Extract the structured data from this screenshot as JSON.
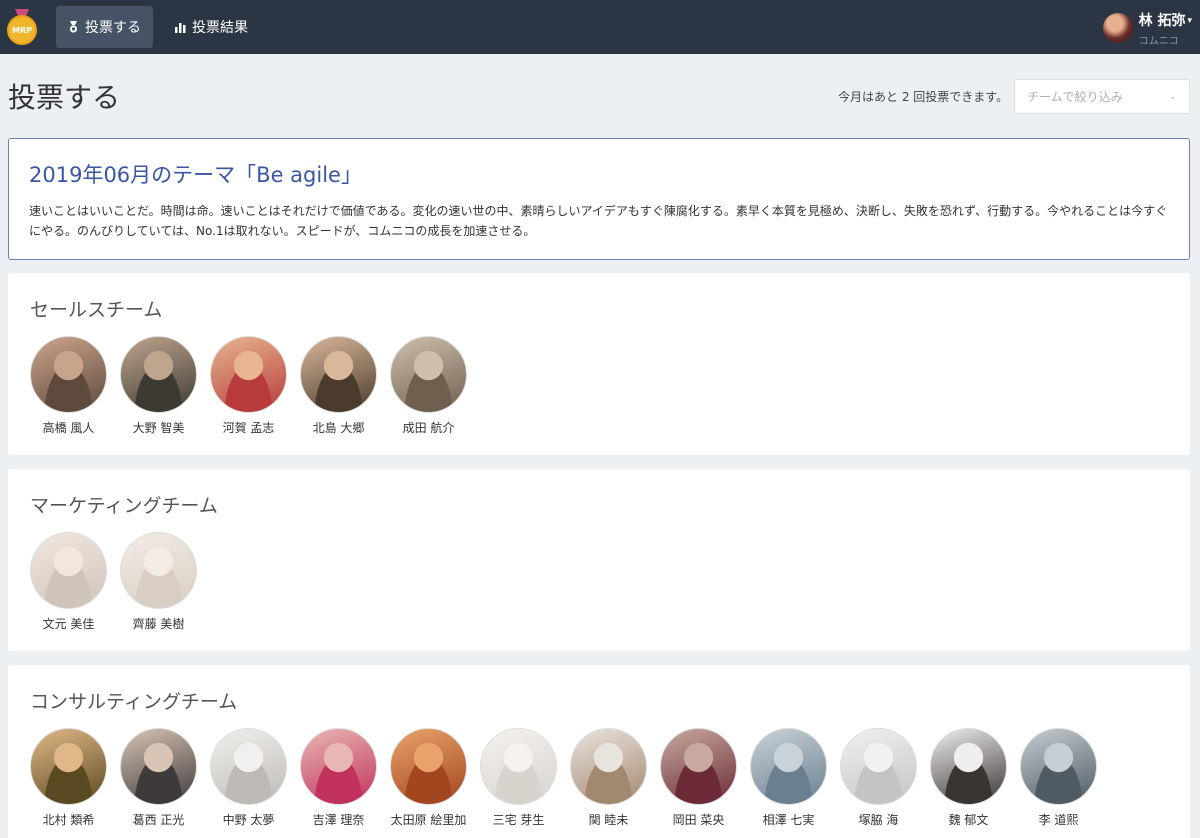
{
  "nav": {
    "logo_text": "MRP",
    "tabs": [
      {
        "label": "投票する",
        "icon": "medal-icon",
        "active": true
      },
      {
        "label": "投票結果",
        "icon": "bar-chart-icon",
        "active": false
      }
    ],
    "user": {
      "name": "林 拓弥",
      "org": "コムニコ"
    }
  },
  "header": {
    "title": "投票する",
    "remaining_text": "今月はあと 2 回投票できます。",
    "filter_placeholder": "チームで絞り込み"
  },
  "theme": {
    "title": "2019年06月のテーマ「Be agile」",
    "description": "速いことはいいことだ。時間は命。速いことはそれだけで価値である。変化の速い世の中、素晴らしいアイデアもすぐ陳腐化する。素早く本質を見極め、決断し、失敗を恐れず、行動する。今やれることは今すぐにやる。のんびりしていては、No.1は取れない。スピードが、コムニコの成長を加速させる。"
  },
  "teams": [
    {
      "name": "セールスチーム",
      "members": [
        "高橋 風人",
        "大野 智美",
        "河賀 孟志",
        "北島 大郷",
        "成田 航介"
      ]
    },
    {
      "name": "マーケティングチーム",
      "members": [
        "文元 美佳",
        "齊藤 美樹"
      ]
    },
    {
      "name": "コンサルティングチーム",
      "members": [
        "北村 類希",
        "葛西 正光",
        "中野 太夢",
        "吉澤 理奈",
        "太田原 絵里加",
        "三宅 芽生",
        "関 睦未",
        "岡田 菜央",
        "相澤 七実",
        "塚脇 海",
        "魏 郁文",
        "李 道熙"
      ]
    }
  ],
  "colors": {
    "navbar": "#2b3544",
    "accent": "#3a55a6",
    "background": "#eceff3"
  }
}
